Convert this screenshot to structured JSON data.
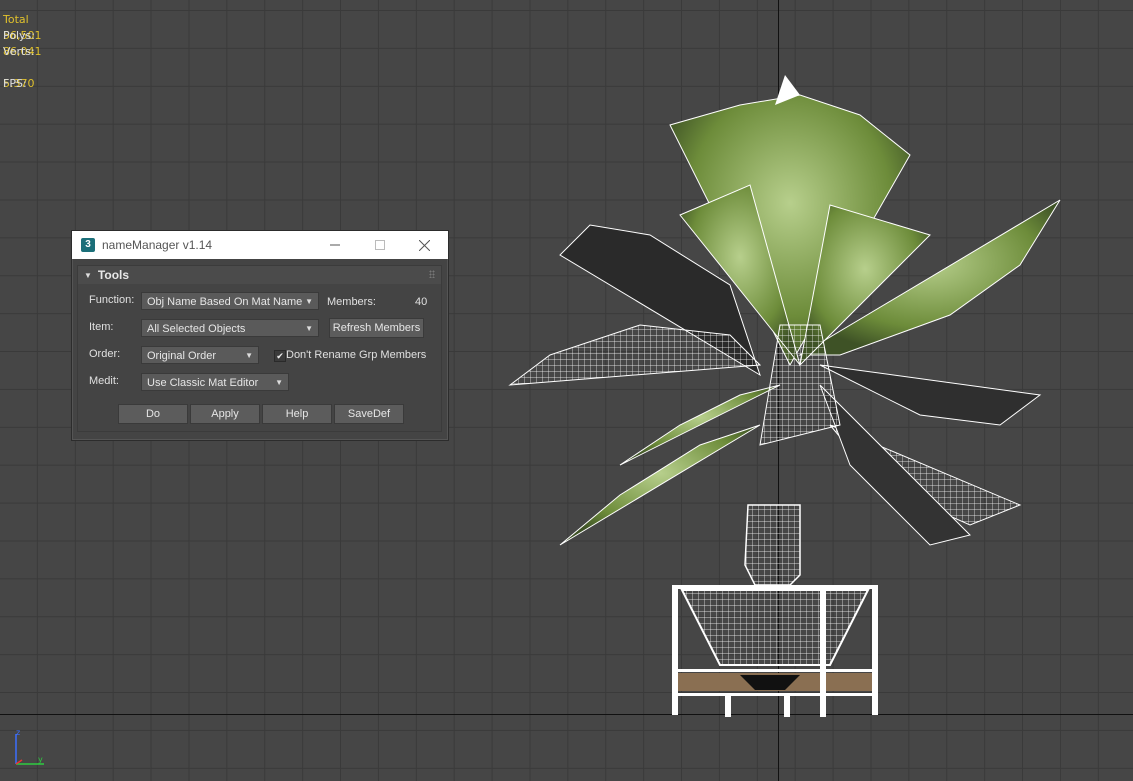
{
  "viewport": {
    "stats": {
      "header": "Total",
      "polys_label": "Polys:",
      "polys_value": "56,501",
      "verts_label": "Verts:",
      "verts_value": "86,041",
      "fps_label": "FPS:",
      "fps_value": "5.370"
    },
    "stats_color": "#e0c12c",
    "gizmo": {
      "z": "z",
      "y": "y",
      "x": "x"
    }
  },
  "dialog": {
    "icon_text": "3",
    "title": "nameManager v1.14",
    "rollout_title": "Tools",
    "function_label": "Function:",
    "function_value": "Obj Name Based On Mat Name",
    "members_label": "Members:",
    "members_value": "40",
    "item_label": "Item:",
    "item_value": "All Selected Objects",
    "refresh_button": "Refresh Members",
    "order_label": "Order:",
    "order_value": "Original Order",
    "dont_rename_label": "Don't Rename Grp Members",
    "dont_rename_checked": true,
    "medit_label": "Medit:",
    "medit_value": "Use Classic Mat Editor",
    "buttons": {
      "do": "Do",
      "apply": "Apply",
      "help": "Help",
      "savedef": "SaveDef"
    }
  }
}
